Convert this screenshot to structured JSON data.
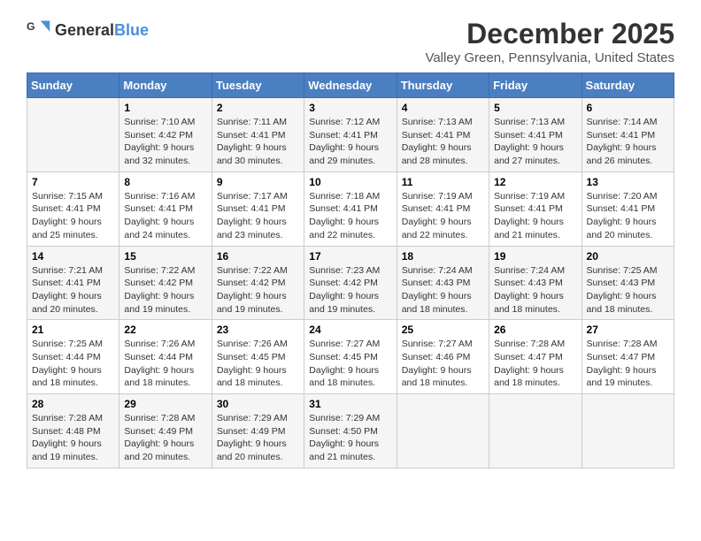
{
  "logo": {
    "general": "General",
    "blue": "Blue"
  },
  "title": "December 2025",
  "location": "Valley Green, Pennsylvania, United States",
  "days_of_week": [
    "Sunday",
    "Monday",
    "Tuesday",
    "Wednesday",
    "Thursday",
    "Friday",
    "Saturday"
  ],
  "weeks": [
    [
      {
        "day": "",
        "sunrise": "",
        "sunset": "",
        "daylight": ""
      },
      {
        "day": "1",
        "sunrise": "Sunrise: 7:10 AM",
        "sunset": "Sunset: 4:42 PM",
        "daylight": "Daylight: 9 hours and 32 minutes."
      },
      {
        "day": "2",
        "sunrise": "Sunrise: 7:11 AM",
        "sunset": "Sunset: 4:41 PM",
        "daylight": "Daylight: 9 hours and 30 minutes."
      },
      {
        "day": "3",
        "sunrise": "Sunrise: 7:12 AM",
        "sunset": "Sunset: 4:41 PM",
        "daylight": "Daylight: 9 hours and 29 minutes."
      },
      {
        "day": "4",
        "sunrise": "Sunrise: 7:13 AM",
        "sunset": "Sunset: 4:41 PM",
        "daylight": "Daylight: 9 hours and 28 minutes."
      },
      {
        "day": "5",
        "sunrise": "Sunrise: 7:13 AM",
        "sunset": "Sunset: 4:41 PM",
        "daylight": "Daylight: 9 hours and 27 minutes."
      },
      {
        "day": "6",
        "sunrise": "Sunrise: 7:14 AM",
        "sunset": "Sunset: 4:41 PM",
        "daylight": "Daylight: 9 hours and 26 minutes."
      }
    ],
    [
      {
        "day": "7",
        "sunrise": "Sunrise: 7:15 AM",
        "sunset": "Sunset: 4:41 PM",
        "daylight": "Daylight: 9 hours and 25 minutes."
      },
      {
        "day": "8",
        "sunrise": "Sunrise: 7:16 AM",
        "sunset": "Sunset: 4:41 PM",
        "daylight": "Daylight: 9 hours and 24 minutes."
      },
      {
        "day": "9",
        "sunrise": "Sunrise: 7:17 AM",
        "sunset": "Sunset: 4:41 PM",
        "daylight": "Daylight: 9 hours and 23 minutes."
      },
      {
        "day": "10",
        "sunrise": "Sunrise: 7:18 AM",
        "sunset": "Sunset: 4:41 PM",
        "daylight": "Daylight: 9 hours and 22 minutes."
      },
      {
        "day": "11",
        "sunrise": "Sunrise: 7:19 AM",
        "sunset": "Sunset: 4:41 PM",
        "daylight": "Daylight: 9 hours and 22 minutes."
      },
      {
        "day": "12",
        "sunrise": "Sunrise: 7:19 AM",
        "sunset": "Sunset: 4:41 PM",
        "daylight": "Daylight: 9 hours and 21 minutes."
      },
      {
        "day": "13",
        "sunrise": "Sunrise: 7:20 AM",
        "sunset": "Sunset: 4:41 PM",
        "daylight": "Daylight: 9 hours and 20 minutes."
      }
    ],
    [
      {
        "day": "14",
        "sunrise": "Sunrise: 7:21 AM",
        "sunset": "Sunset: 4:41 PM",
        "daylight": "Daylight: 9 hours and 20 minutes."
      },
      {
        "day": "15",
        "sunrise": "Sunrise: 7:22 AM",
        "sunset": "Sunset: 4:42 PM",
        "daylight": "Daylight: 9 hours and 19 minutes."
      },
      {
        "day": "16",
        "sunrise": "Sunrise: 7:22 AM",
        "sunset": "Sunset: 4:42 PM",
        "daylight": "Daylight: 9 hours and 19 minutes."
      },
      {
        "day": "17",
        "sunrise": "Sunrise: 7:23 AM",
        "sunset": "Sunset: 4:42 PM",
        "daylight": "Daylight: 9 hours and 19 minutes."
      },
      {
        "day": "18",
        "sunrise": "Sunrise: 7:24 AM",
        "sunset": "Sunset: 4:43 PM",
        "daylight": "Daylight: 9 hours and 18 minutes."
      },
      {
        "day": "19",
        "sunrise": "Sunrise: 7:24 AM",
        "sunset": "Sunset: 4:43 PM",
        "daylight": "Daylight: 9 hours and 18 minutes."
      },
      {
        "day": "20",
        "sunrise": "Sunrise: 7:25 AM",
        "sunset": "Sunset: 4:43 PM",
        "daylight": "Daylight: 9 hours and 18 minutes."
      }
    ],
    [
      {
        "day": "21",
        "sunrise": "Sunrise: 7:25 AM",
        "sunset": "Sunset: 4:44 PM",
        "daylight": "Daylight: 9 hours and 18 minutes."
      },
      {
        "day": "22",
        "sunrise": "Sunrise: 7:26 AM",
        "sunset": "Sunset: 4:44 PM",
        "daylight": "Daylight: 9 hours and 18 minutes."
      },
      {
        "day": "23",
        "sunrise": "Sunrise: 7:26 AM",
        "sunset": "Sunset: 4:45 PM",
        "daylight": "Daylight: 9 hours and 18 minutes."
      },
      {
        "day": "24",
        "sunrise": "Sunrise: 7:27 AM",
        "sunset": "Sunset: 4:45 PM",
        "daylight": "Daylight: 9 hours and 18 minutes."
      },
      {
        "day": "25",
        "sunrise": "Sunrise: 7:27 AM",
        "sunset": "Sunset: 4:46 PM",
        "daylight": "Daylight: 9 hours and 18 minutes."
      },
      {
        "day": "26",
        "sunrise": "Sunrise: 7:28 AM",
        "sunset": "Sunset: 4:47 PM",
        "daylight": "Daylight: 9 hours and 18 minutes."
      },
      {
        "day": "27",
        "sunrise": "Sunrise: 7:28 AM",
        "sunset": "Sunset: 4:47 PM",
        "daylight": "Daylight: 9 hours and 19 minutes."
      }
    ],
    [
      {
        "day": "28",
        "sunrise": "Sunrise: 7:28 AM",
        "sunset": "Sunset: 4:48 PM",
        "daylight": "Daylight: 9 hours and 19 minutes."
      },
      {
        "day": "29",
        "sunrise": "Sunrise: 7:28 AM",
        "sunset": "Sunset: 4:49 PM",
        "daylight": "Daylight: 9 hours and 20 minutes."
      },
      {
        "day": "30",
        "sunrise": "Sunrise: 7:29 AM",
        "sunset": "Sunset: 4:49 PM",
        "daylight": "Daylight: 9 hours and 20 minutes."
      },
      {
        "day": "31",
        "sunrise": "Sunrise: 7:29 AM",
        "sunset": "Sunset: 4:50 PM",
        "daylight": "Daylight: 9 hours and 21 minutes."
      },
      {
        "day": "",
        "sunrise": "",
        "sunset": "",
        "daylight": ""
      },
      {
        "day": "",
        "sunrise": "",
        "sunset": "",
        "daylight": ""
      },
      {
        "day": "",
        "sunrise": "",
        "sunset": "",
        "daylight": ""
      }
    ]
  ]
}
